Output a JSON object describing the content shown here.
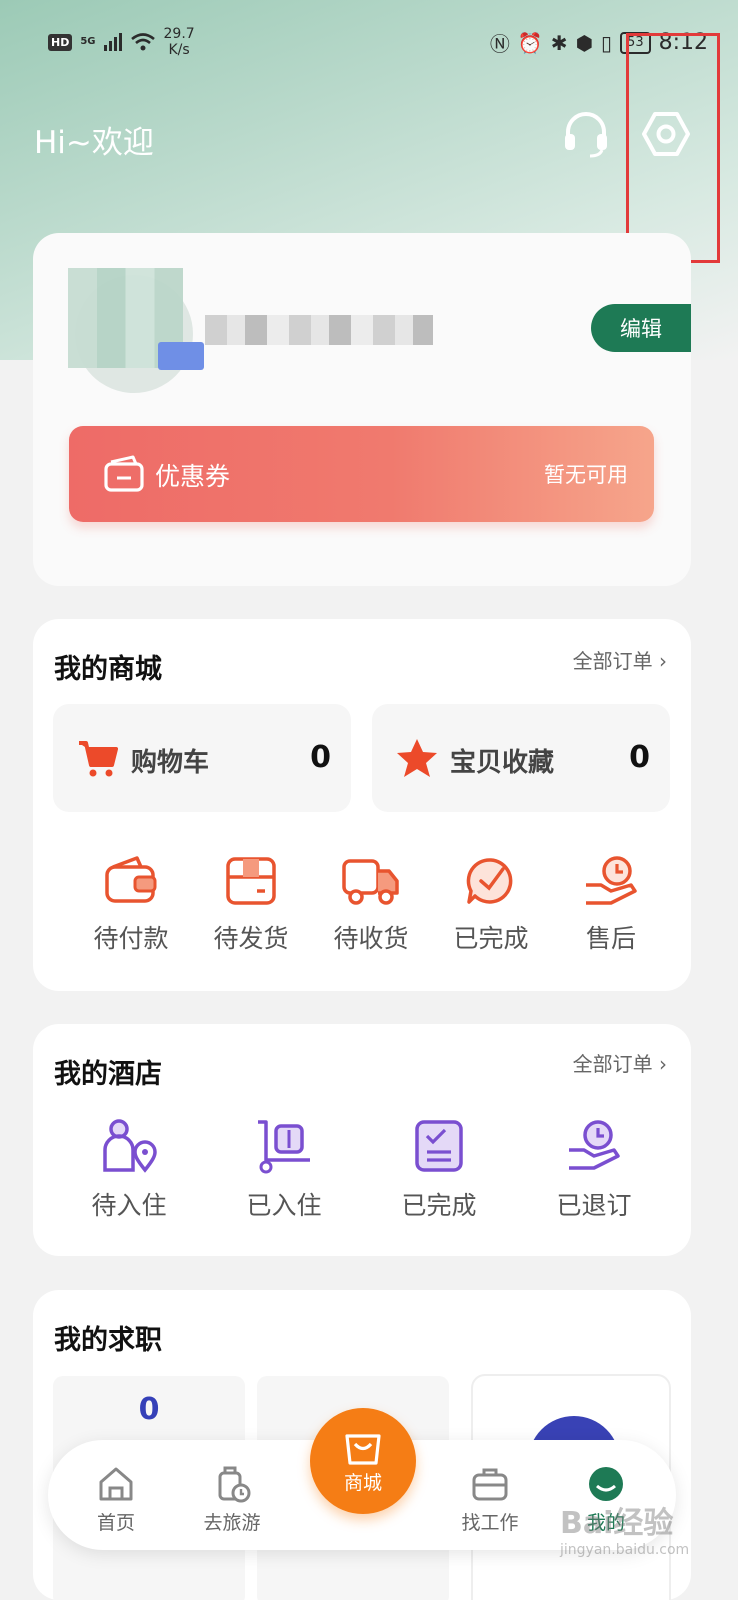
{
  "status_bar": {
    "hd": "HD",
    "network": "5G",
    "speed_value": "29.7",
    "speed_unit": "K/s",
    "battery": "53",
    "time": "8:12"
  },
  "header": {
    "greeting": "Hi~欢迎",
    "icons": [
      "headset-icon",
      "settings-icon"
    ]
  },
  "profile": {
    "edit_label": "编辑",
    "coupon": {
      "title": "优惠券",
      "status": "暂无可用"
    }
  },
  "mall": {
    "title": "我的商城",
    "all_orders": "全部订单",
    "cart": {
      "label": "购物车",
      "count": "0"
    },
    "favorites": {
      "label": "宝贝收藏",
      "count": "0"
    },
    "statuses": [
      "待付款",
      "待发货",
      "待收货",
      "已完成",
      "售后"
    ]
  },
  "hotel": {
    "title": "我的酒店",
    "all_orders": "全部订单",
    "statuses": [
      "待入住",
      "已入住",
      "已完成",
      "已退订"
    ]
  },
  "jobs": {
    "title": "我的求职",
    "stat_1": "0"
  },
  "tabbar": {
    "items": [
      "首页",
      "去旅游",
      "商城",
      "找工作",
      "我的"
    ]
  },
  "watermark": {
    "brand": "Bai经验",
    "sub": "jingyan.baidu.com"
  },
  "colors": {
    "accent_orange": "#f57d15",
    "edit_green": "#1e7a55",
    "coupon_red": "#ee6b67",
    "icon_orange": "#e8542f",
    "icon_purple": "#7a4fd0",
    "highlight_red": "#e23a3a"
  }
}
